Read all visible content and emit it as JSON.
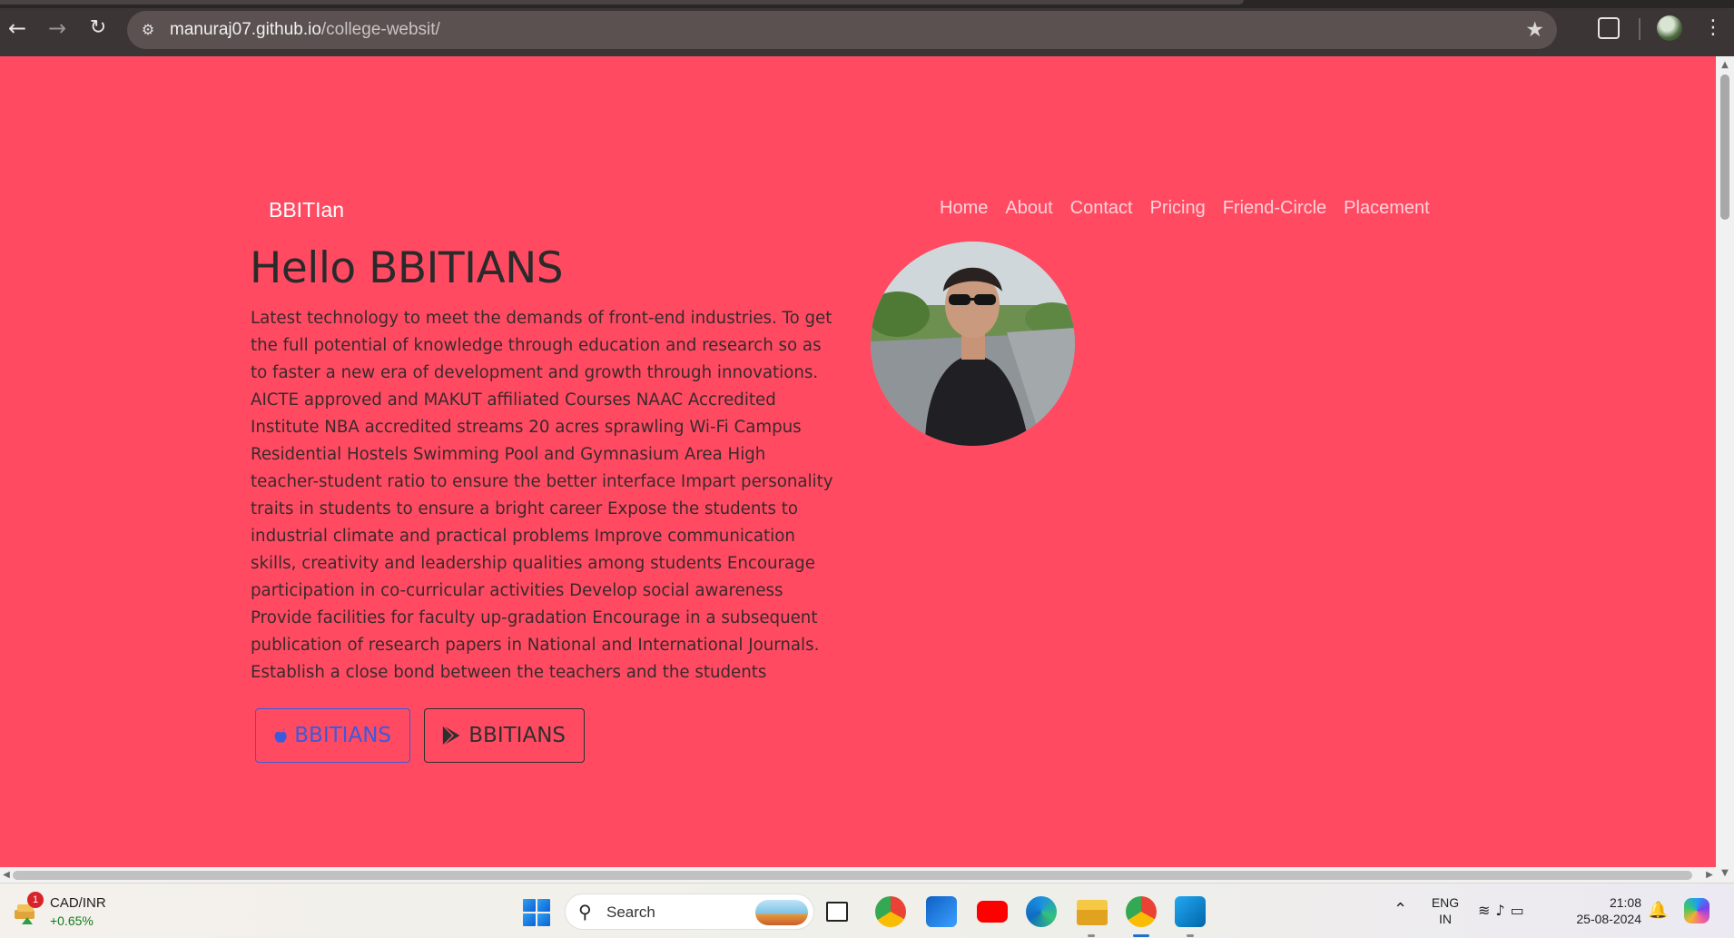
{
  "browser": {
    "url_host": "manuraj07.github.io",
    "url_path": "/college-websit/"
  },
  "page": {
    "brand": "BBITIan",
    "nav": [
      "Home",
      "About",
      "Contact",
      "Pricing",
      "Friend-Circle",
      "Placement"
    ],
    "hero_title": "Hello BBITIANS",
    "hero_text": "Latest technology to meet the demands of front-end industries. To get the full potential of knowledge through education and research so as to faster a new era of development and growth through innovations. AICTE approved and MAKUT affiliated Courses NAAC Accredited Institute NBA accredited streams 20 acres sprawling Wi-Fi Campus Residential Hostels Swimming Pool and Gymnasium Area High teacher-student ratio to ensure the better interface Impart personality traits in students to ensure a bright career Expose the students to industrial climate and practical problems Improve communication skills, creativity and leadership qualities among students Encourage participation in co-curricular activities Develop social awareness Provide facilities for faculty up-gradation Encourage in a subsequent publication of research papers in National and International Journals. Establish a close bond between the teachers and the students",
    "button_apple_label": "BBITIANS",
    "button_play_label": "BBITIANS",
    "colors": {
      "background": "#ff4a62",
      "apple_button": "#3b5bdb",
      "title": "#2a2a2a"
    }
  },
  "taskbar": {
    "weather_badge": "1",
    "ticker_name": "CAD/INR",
    "ticker_value": "+0.65%",
    "search_label": "Search",
    "lang_line1": "ENG",
    "lang_line2": "IN",
    "time": "21:08",
    "date": "25-08-2024",
    "apps": [
      "task-view",
      "chrome",
      "outlook-new",
      "youtube",
      "edge",
      "file-explorer",
      "chrome-profile",
      "vscode"
    ]
  }
}
